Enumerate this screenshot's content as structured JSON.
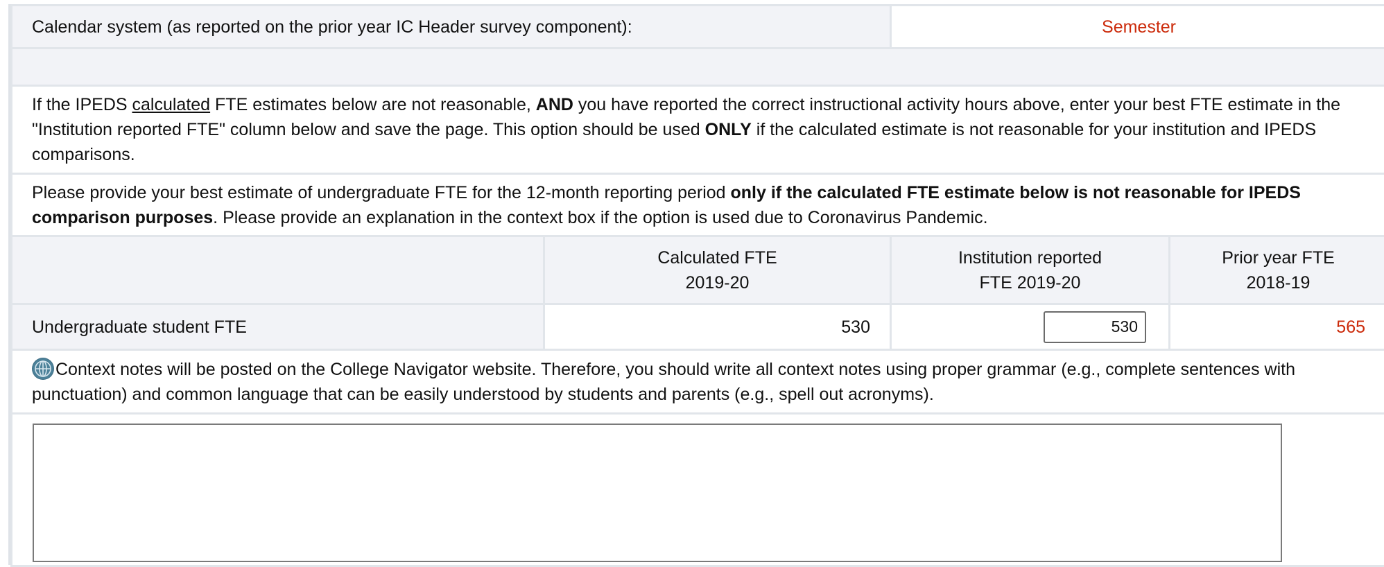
{
  "calendar": {
    "label": "Calendar system (as reported on the prior year IC Header survey component):",
    "value": "Semester"
  },
  "instructions": {
    "p1_a": "If the IPEDS ",
    "p1_underline": "calculated",
    "p1_b": " FTE estimates below are not reasonable, ",
    "p1_bold1": "AND",
    "p1_c": " you have reported the correct instructional activity hours above, enter your best FTE estimate in the \"Institution reported FTE\" column below and save the page. This option should be used ",
    "p1_bold2": "ONLY",
    "p1_d": " if the calculated estimate is not reasonable for your institution and IPEDS comparisons.",
    "p2_a": "Please provide your best estimate of undergraduate FTE for the 12-month reporting period ",
    "p2_bold": "only if the calculated FTE estimate below is not reasonable for IPEDS comparison purposes",
    "p2_b": ". Please provide an explanation in the context box if the option is used due to Coronavirus Pandemic."
  },
  "table": {
    "headers": {
      "calculated_l1": "Calculated FTE",
      "calculated_l2": "2019-20",
      "reported_l1": "Institution reported",
      "reported_l2": "FTE 2019-20",
      "prior_l1": "Prior year FTE",
      "prior_l2": "2018-19"
    },
    "row": {
      "label": "Undergraduate student FTE",
      "calculated": "530",
      "reported": "530",
      "prior": "565"
    }
  },
  "context": {
    "icon": "globe-icon",
    "note": "Context notes will be posted on the College Navigator website. Therefore, you should write all context notes using proper grammar (e.g., complete sentences with punctuation) and common language that can be easily understood by students and parents (e.g., spell out acronyms).",
    "textarea_value": ""
  },
  "colors": {
    "accent_red": "#cc2b0b",
    "shade": "#f2f3f7",
    "border": "#e1e5ea"
  }
}
